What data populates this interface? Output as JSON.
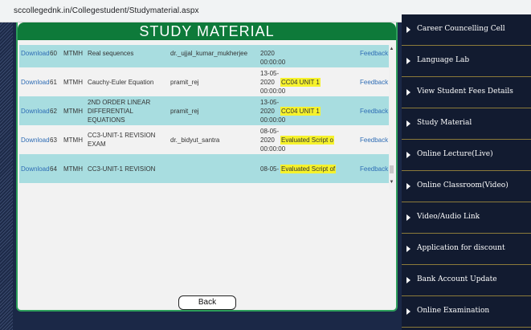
{
  "browser": {
    "url": "sccollegednk.in/Collegestudent/Studymaterial.aspx"
  },
  "panel": {
    "title": "STUDY MATERIAL",
    "back_label": "Back",
    "rows": [
      {
        "download": "Download",
        "id": "60",
        "subject": "MTMH",
        "title": "Real sequences",
        "uploaded_by": "dr._ujjal_kumar_mukherjee",
        "date": "2020 00:00:00",
        "remark": "",
        "feedback": "Feedback"
      },
      {
        "download": "Download",
        "id": "61",
        "subject": "MTMH",
        "title": "Cauchy-Euler Equation",
        "uploaded_by": "pramit_rej",
        "date": "13-05-2020 00:00:00",
        "remark": "CC04 UNIT 1",
        "feedback": "Feedback"
      },
      {
        "download": "Download",
        "id": "62",
        "subject": "MTMH",
        "title": "2ND ORDER LINEAR DIFFERENTIAL EQUATIONS",
        "uploaded_by": "pramit_rej",
        "date": "13-05-2020 00:00:00",
        "remark": "CC04 UNIT 1",
        "feedback": "Feedback"
      },
      {
        "download": "Download",
        "id": "63",
        "subject": "MTMH",
        "title": "CC3-UNIT-1 REVISION EXAM",
        "uploaded_by": "dr._bidyut_santra",
        "date": "08-05-2020 00:00:00",
        "remark": "Evaluated Script o",
        "feedback": "Feedback"
      },
      {
        "download": "Download",
        "id": "64",
        "subject": "MTMH",
        "title": "CC3-UNIT-1 REVISION",
        "uploaded_by": "",
        "date": "08-05-",
        "remark": "Evaluated Script of",
        "feedback": "Feedback"
      }
    ]
  },
  "sidebar": {
    "items": [
      {
        "label": "Career Councelling Cell"
      },
      {
        "label": "Language Lab"
      },
      {
        "label": "View Student Fees Details"
      },
      {
        "label": "Study Material"
      },
      {
        "label": "Online Lecture(Live)"
      },
      {
        "label": "Online Classroom(Video)"
      },
      {
        "label": "Video/Audio Link"
      },
      {
        "label": "Application for discount"
      },
      {
        "label": "Bank Account Update"
      },
      {
        "label": "Online Examination"
      }
    ]
  }
}
